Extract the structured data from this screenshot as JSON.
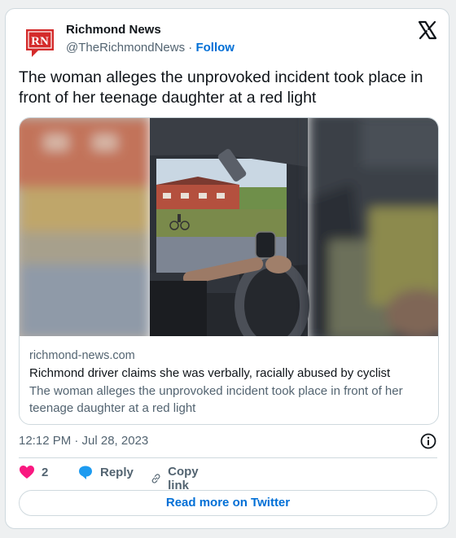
{
  "author": {
    "name": "Richmond News",
    "handle": "@TheRichmondNews",
    "separator": "·",
    "follow_label": "Follow",
    "logo_text": "RN"
  },
  "tweet": {
    "text": "The woman alleges the unprovoked incident took place in front of her teenage daughter at a red light"
  },
  "link_card": {
    "domain": "richmond-news.com",
    "headline": "Richmond driver claims she was verbally, racially abused by cyclist",
    "description": "The woman alleges the unprovoked incident took place in front of her teenage daughter at a red light"
  },
  "meta": {
    "timestamp": "12:12 PM · Jul 28, 2023"
  },
  "actions": {
    "like_count": "2",
    "reply_label": "Reply",
    "copy_label": "Copy link"
  },
  "read_more_label": "Read more on Twitter",
  "colors": {
    "brand_link": "#006fd6",
    "like": "#f91880",
    "reply": "#1d9bf0",
    "logo_red": "#d42a2a"
  },
  "icons": [
    "x-logo-icon",
    "info-icon",
    "heart-icon",
    "reply-bubble-icon",
    "link-icon"
  ]
}
